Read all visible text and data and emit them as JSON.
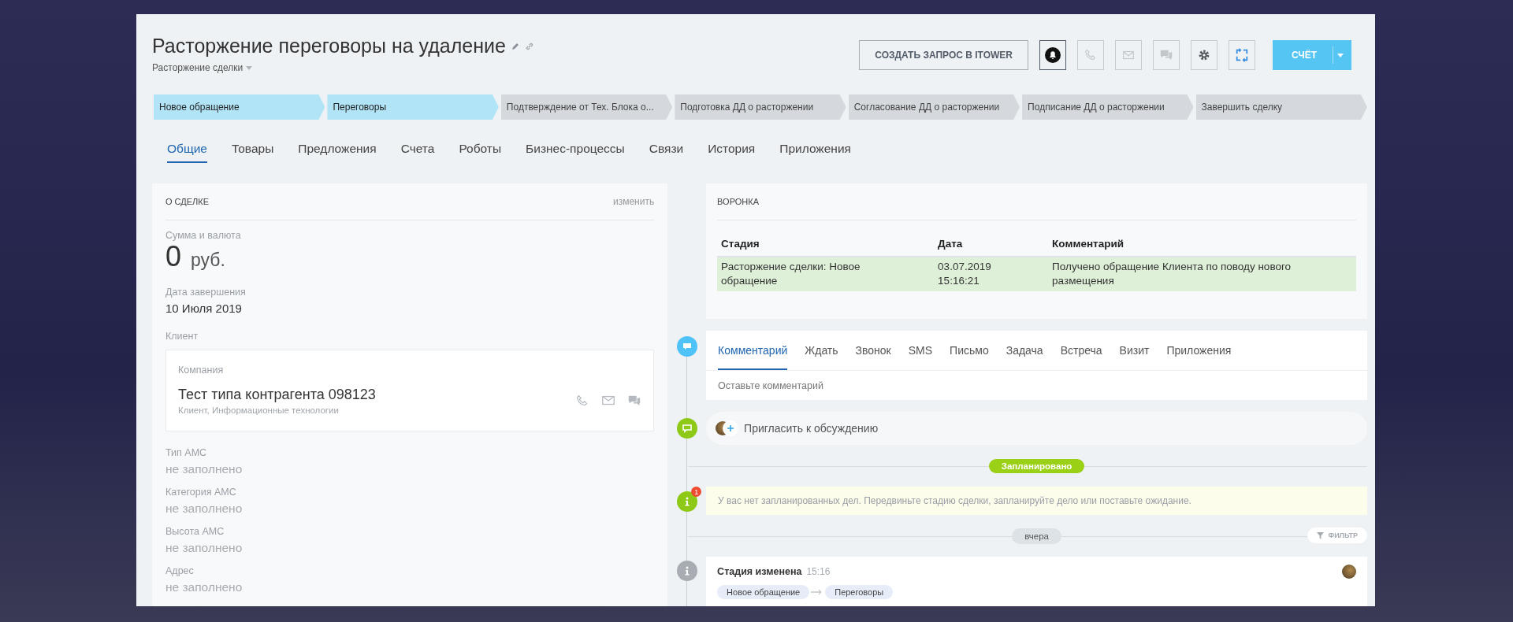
{
  "header": {
    "title": "Расторжение переговоры на удаление",
    "category": "Расторжение сделки",
    "create_request_button": "СОЗДАТЬ ЗАПРОС В ITOWER",
    "toolbar_buttons": [
      {
        "kind": "bell",
        "active": true
      },
      {
        "kind": "phone",
        "active": false
      },
      {
        "kind": "mail",
        "active": false
      },
      {
        "kind": "chat",
        "active": false
      },
      {
        "kind": "settings",
        "active": false
      },
      {
        "kind": "expand",
        "active": false
      }
    ],
    "invoice_button": "СЧЁТ"
  },
  "stages": [
    {
      "label": "Новое обращение",
      "reached": true
    },
    {
      "label": "Переговоры",
      "reached": true
    },
    {
      "label": "Подтверждение от Тех. Блока о...",
      "reached": false
    },
    {
      "label": "Подготовка ДД о расторжении",
      "reached": false
    },
    {
      "label": "Согласование ДД о расторжении",
      "reached": false
    },
    {
      "label": "Подписание ДД о расторжении",
      "reached": false
    },
    {
      "label": "Завершить сделку",
      "reached": false
    }
  ],
  "tabs": [
    {
      "label": "Общие",
      "selected": true
    },
    {
      "label": "Товары",
      "selected": false
    },
    {
      "label": "Предложения",
      "selected": false
    },
    {
      "label": "Счета",
      "selected": false
    },
    {
      "label": "Роботы",
      "selected": false
    },
    {
      "label": "Бизнес-процессы",
      "selected": false
    },
    {
      "label": "Связи",
      "selected": false
    },
    {
      "label": "История",
      "selected": false
    },
    {
      "label": "Приложения",
      "selected": false
    }
  ],
  "deal_card": {
    "title": "О СДЕЛКЕ",
    "edit_link": "изменить",
    "amount_label": "Сумма и валюта",
    "amount": "0",
    "currency": "руб.",
    "date_field": {
      "label": "Дата завершения",
      "value": "10 Июля 2019",
      "filled": true
    },
    "client_label": "Клиент",
    "client": {
      "type": "Компания",
      "name": "Тест типа контрагента 098123",
      "description": "Клиент, Информационные технологии"
    },
    "fields": [
      {
        "label": "Тип АМС",
        "value": "не заполнено",
        "filled": false
      },
      {
        "label": "Категория АМС",
        "value": "не заполнено",
        "filled": false
      },
      {
        "label": "Высота АМС",
        "value": "не заполнено",
        "filled": false
      },
      {
        "label": "Адрес",
        "value": "не заполнено",
        "filled": false
      }
    ]
  },
  "funnel": {
    "title": "ВОРОНКА",
    "columns": [
      "Стадия",
      "Дата",
      "Комментарий"
    ],
    "rows": [
      {
        "cells": [
          "Расторжение сделки: Новое обращение",
          "03.07.2019 15:16:21",
          "Получено обращение Клиента по поводу нового размещения"
        ],
        "highlighted": true
      }
    ]
  },
  "timeline": {
    "composer": {
      "color": "#4fc3f7",
      "tabs": [
        {
          "label": "Комментарий",
          "selected": true
        },
        {
          "label": "Ждать",
          "selected": false
        },
        {
          "label": "Звонок",
          "selected": false
        },
        {
          "label": "SMS",
          "selected": false
        },
        {
          "label": "Письмо",
          "selected": false
        },
        {
          "label": "Задача",
          "selected": false
        },
        {
          "label": "Встреча",
          "selected": false
        },
        {
          "label": "Визит",
          "selected": false
        },
        {
          "label": "Приложения",
          "selected": false
        }
      ],
      "placeholder": "Оставьте комментарий"
    },
    "invite": {
      "color": "#8fc918",
      "text": "Пригласить к обсуждению"
    },
    "planned_label": "Запланировано",
    "notice": {
      "color": "#8fc918",
      "badge": "1",
      "text": "У вас нет запланированных дел. Передвиньте стадию сделки, запланируйте дело или поставьте ожидание."
    },
    "day_label": "вчера",
    "filter_button": "ФИЛЬТР",
    "event": {
      "color": "#a8adb4",
      "title": "Стадия изменена",
      "time": "15:16",
      "from": "Новое обращение",
      "to": "Переговоры"
    }
  }
}
